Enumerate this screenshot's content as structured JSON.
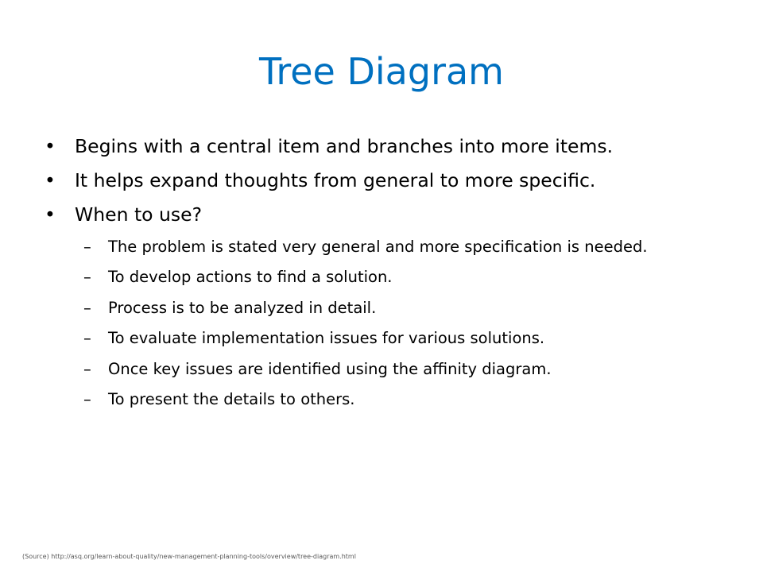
{
  "slide": {
    "title": "Tree Diagram",
    "bullet_marker": "•",
    "sub_marker": "–",
    "bullets": [
      "Begins with a central item and branches into more items.",
      "It helps expand thoughts from general to more specific.",
      "When to use?"
    ],
    "sub_bullets": [
      "The problem is stated very general and more specification is needed.",
      "To develop actions to find a solution.",
      "Process is to be analyzed in detail.",
      "To evaluate implementation issues for various solutions.",
      "Once key issues are identified using the affinity diagram.",
      "To present the details to others."
    ],
    "source": "(Source) http://asq.org/learn-about-quality/new-management-planning-tools/overview/tree-diagram.html"
  }
}
